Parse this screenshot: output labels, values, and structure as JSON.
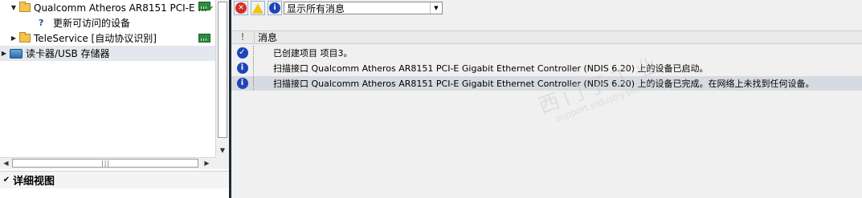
{
  "tree": {
    "items": [
      {
        "label": "Qualcomm Atheros AR8151 PCI-E ...",
        "expanded": true
      },
      {
        "label": "更新可访问的设备"
      },
      {
        "label": "TeleService [自动协议识别]",
        "expanded": false
      },
      {
        "label": "读卡器/USB 存储器",
        "expanded": false
      }
    ]
  },
  "detail_view": {
    "label": "详细视图"
  },
  "toolbar": {
    "filter_value": "显示所有消息",
    "error_glyph": "✕",
    "warning_glyph": "!",
    "info_glyph": "i"
  },
  "messages": {
    "header_icon_col": "!",
    "header_message_col": "消息",
    "rows": [
      {
        "icon": "success-check",
        "text": "已创建项目 项目3。"
      },
      {
        "icon": "info",
        "text": "扫描接口 Qualcomm Atheros AR8151 PCI-E Gigabit Ethernet Controller (NDIS 6.20) 上的设备已启动。"
      },
      {
        "icon": "info",
        "text": "扫描接口 Qualcomm Atheros AR8151 PCI-E Gigabit Ethernet Controller (NDIS 6.20) 上的设备已完成。在网络上未找到任何设备。"
      }
    ]
  },
  "watermark": {
    "text": "西门子工业",
    "sub": "support.industry.siemens"
  },
  "colors": {
    "selection": "#d6dbe1",
    "info_blue": "#1f45b8",
    "error_red": "#d62a2a",
    "warning_yellow": "#f2c417",
    "device_green": "#2e8b3e",
    "divider": "#1f2a33"
  }
}
